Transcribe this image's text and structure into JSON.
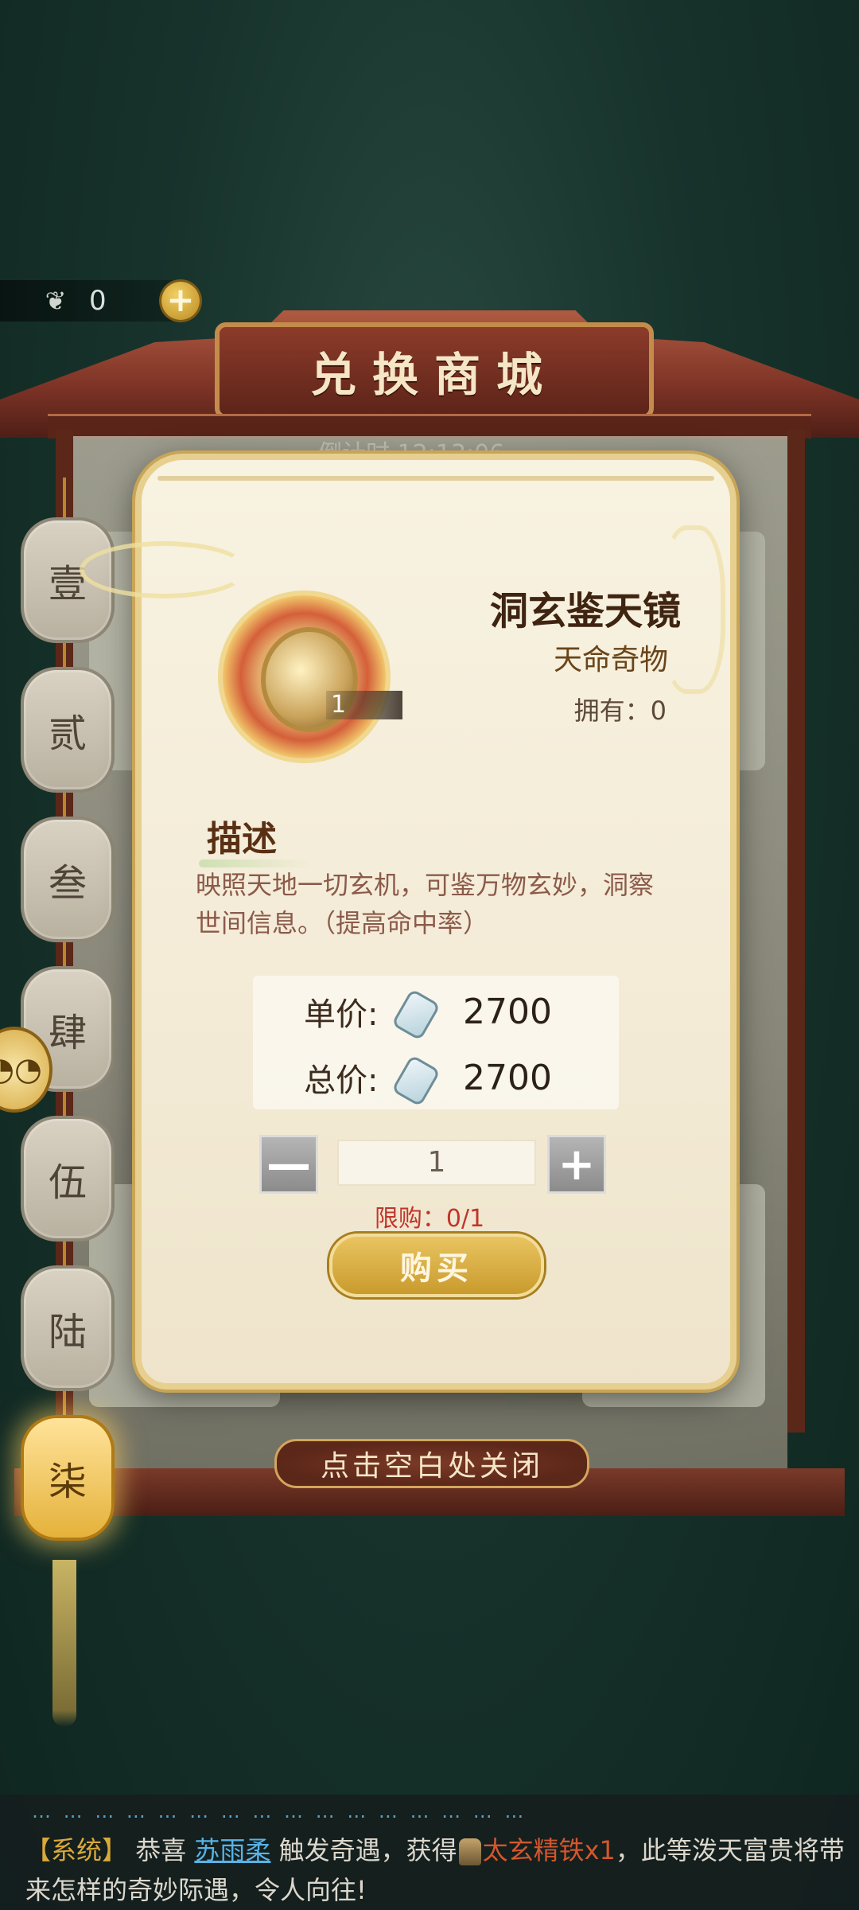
{
  "currency": {
    "count": "0",
    "plus_label": "+"
  },
  "header": {
    "title": "兑换商城",
    "countdown": "倒计时 12:13:06"
  },
  "lanterns": [
    "壹",
    "贰",
    "叁",
    "肆",
    "伍",
    "陆",
    "柒"
  ],
  "active_lantern_index": 6,
  "side_button_label": "◔◔",
  "modal": {
    "item_name": "洞玄鉴天镜",
    "item_type": "天命奇物",
    "item_qty_tag": "1",
    "owned_label": "拥有：",
    "owned_value": "0",
    "desc_title": "描述",
    "desc_text": "映照天地一切玄机，可鉴万物玄妙，洞察世间信息。（提高命中率）",
    "unit_price_label": "单价:",
    "unit_price_value": "2700",
    "total_price_label": "总价:",
    "total_price_value": "2700",
    "minus_label": "—",
    "plus_label": "+",
    "quantity": "1",
    "limit_text": "限购：0/1",
    "buy_label": "购买"
  },
  "close_hint": "点击空白处关闭",
  "chat": {
    "dots": "… … … … … … … … … … … … … … … …",
    "tag": "【系统】",
    "prefix": "恭喜",
    "user": "苏雨柔",
    "middle": "触发奇遇，获得",
    "item": "太玄精铁x1",
    "suffix": "，此等泼天富贵将带来怎样的奇妙际遇，令人向往!"
  }
}
